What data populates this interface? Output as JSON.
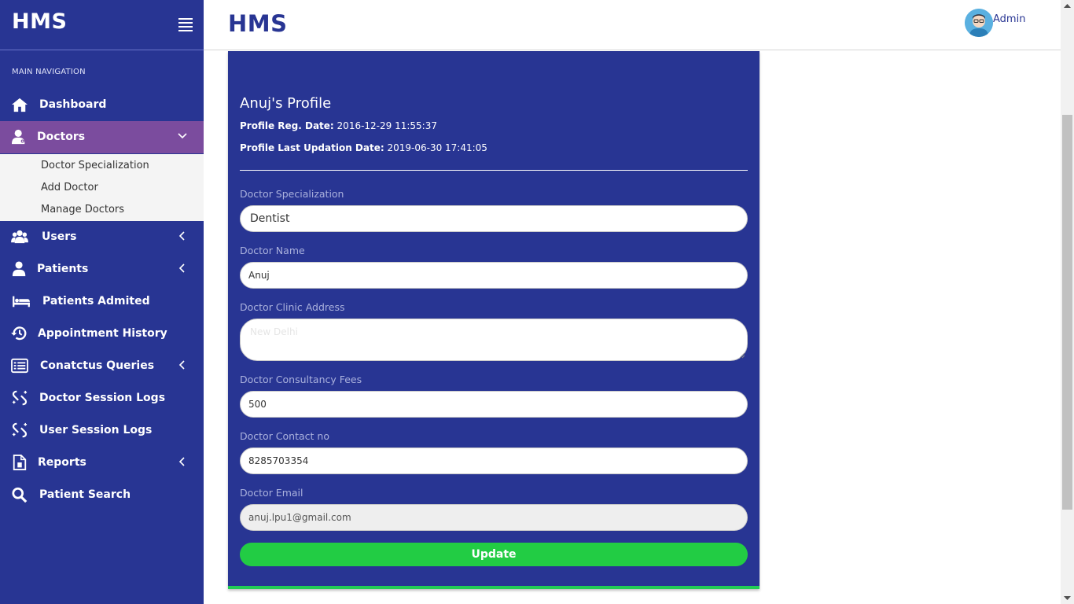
{
  "app": {
    "brand": "HMS",
    "page_title": "HMS"
  },
  "user": {
    "name": "Admin"
  },
  "sidebar": {
    "header": "MAIN NAVIGATION",
    "items": [
      {
        "label": "Dashboard",
        "icon": "home-icon"
      },
      {
        "label": "Doctors",
        "icon": "doctor-icon",
        "expanded": true
      },
      {
        "label": "Users",
        "icon": "users-icon"
      },
      {
        "label": "Patients",
        "icon": "patient-icon"
      },
      {
        "label": "Patients Admited",
        "icon": "bed-icon"
      },
      {
        "label": "Appointment History",
        "icon": "history-icon"
      },
      {
        "label": "Conatctus Queries",
        "icon": "list-icon"
      },
      {
        "label": "Doctor Session Logs",
        "icon": "logs-icon"
      },
      {
        "label": "User Session Logs",
        "icon": "logs-icon"
      },
      {
        "label": "Reports",
        "icon": "report-icon"
      },
      {
        "label": "Patient Search",
        "icon": "search-icon"
      }
    ],
    "doctors_sub": [
      "Doctor Specialization",
      "Add Doctor",
      "Manage Doctors"
    ]
  },
  "profile": {
    "title": "Anuj's Profile",
    "reg_label": "Profile Reg. Date:",
    "reg_value": "2016-12-29 11:55:37",
    "upd_label": "Profile Last Updation Date:",
    "upd_value": "2019-06-30 17:41:05"
  },
  "form": {
    "specialization_label": "Doctor Specialization",
    "specialization_value": "Dentist",
    "name_label": "Doctor Name",
    "name_value": "Anuj",
    "address_label": "Doctor Clinic Address",
    "address_value": "New Delhi",
    "fees_label": "Doctor Consultancy Fees",
    "fees_value": "500",
    "contact_label": "Doctor Contact no",
    "contact_value": "8285703354",
    "email_label": "Doctor Email",
    "email_value": "anuj.lpu1@gmail.com",
    "submit_label": "Update"
  },
  "colors": {
    "sidebar": "#283593",
    "active": "#7b4c9e",
    "button": "#22cc44"
  }
}
